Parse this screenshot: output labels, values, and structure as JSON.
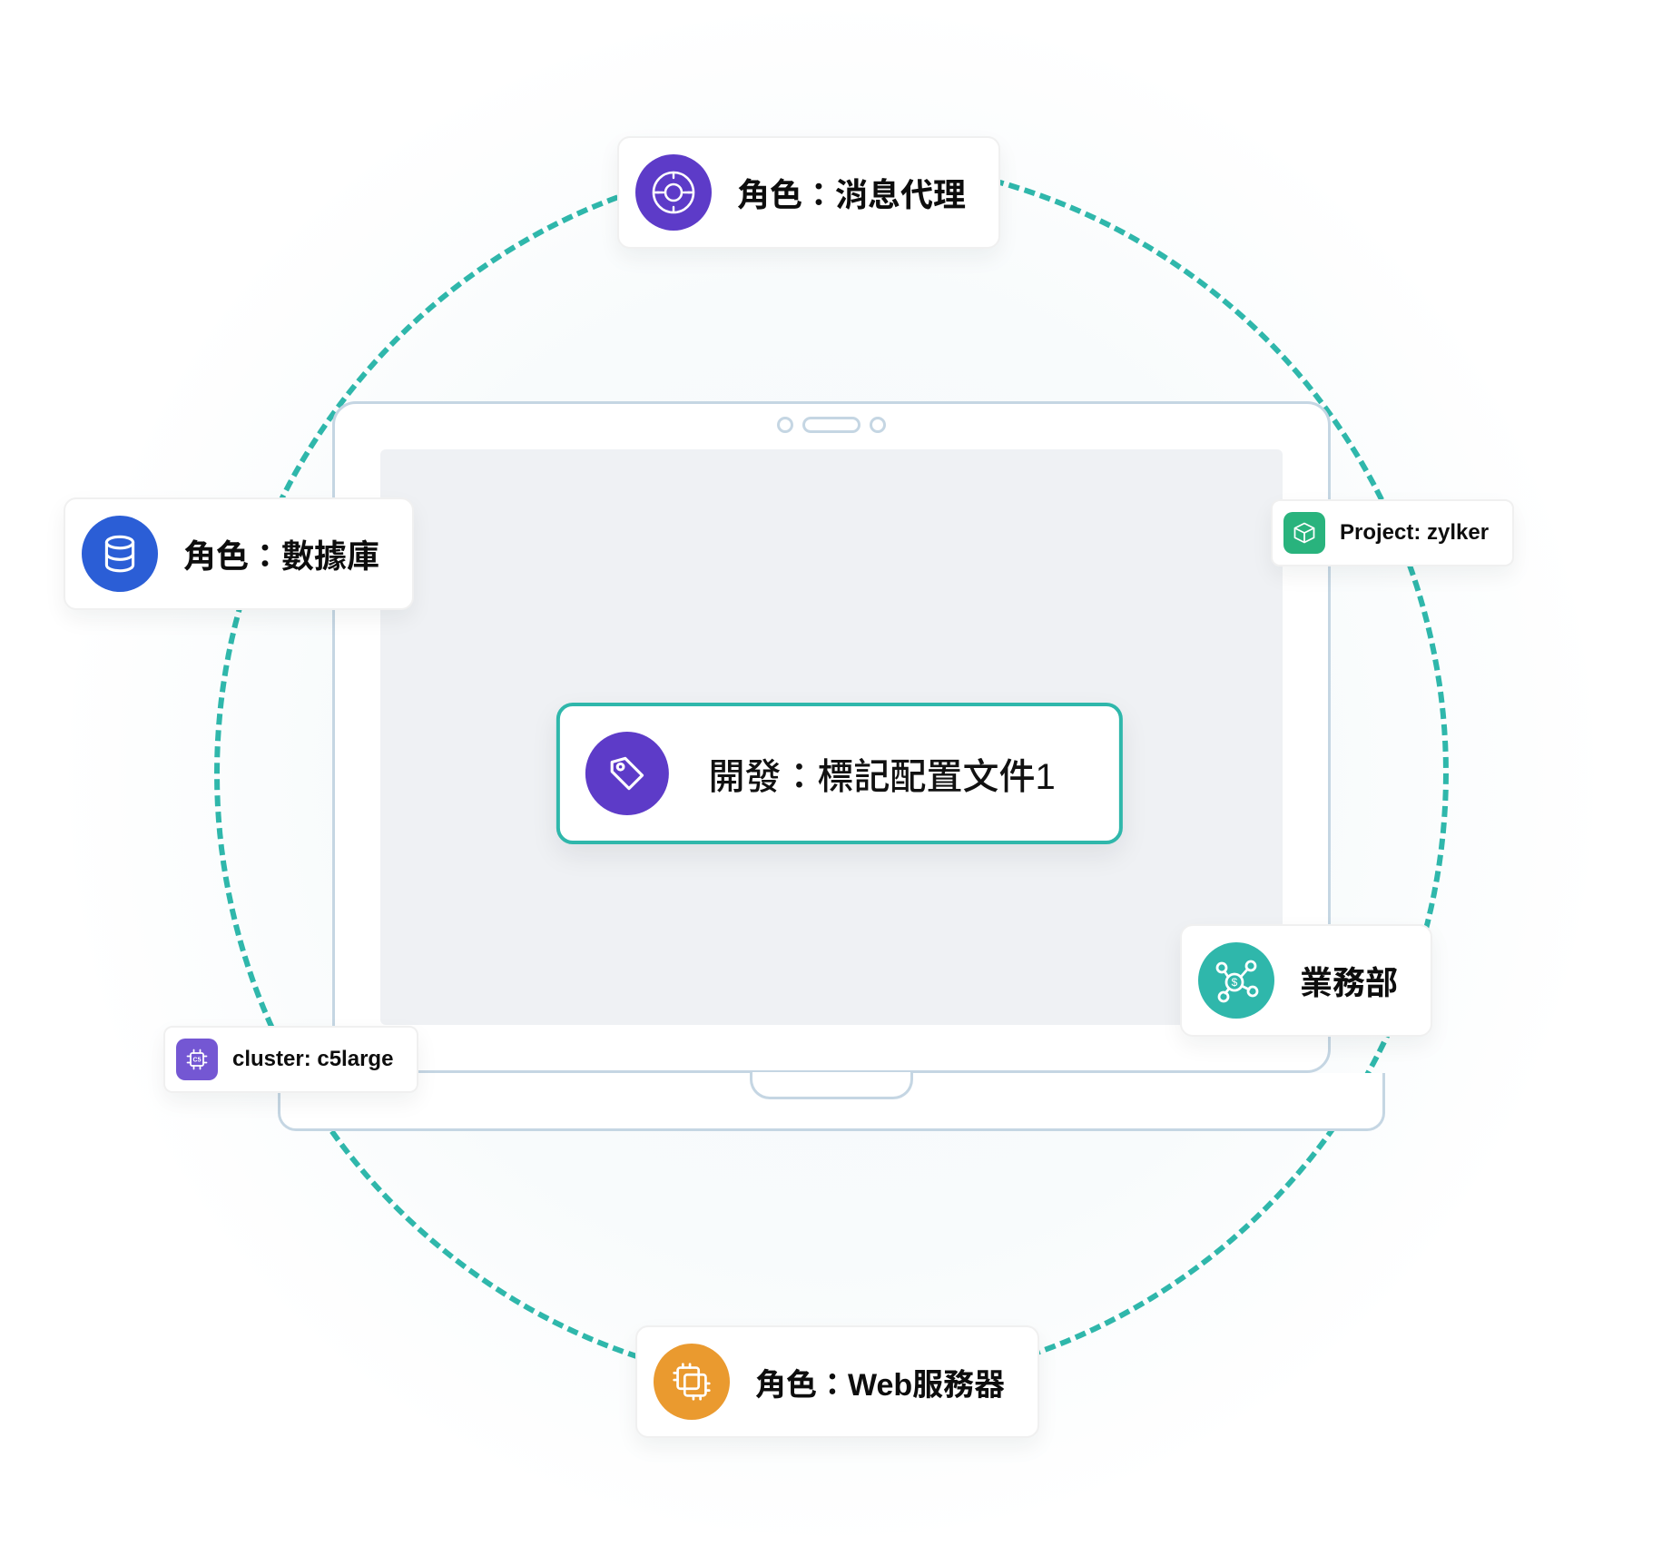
{
  "diagram": {
    "center": {
      "label": "開發：標記配置文件1",
      "icon": "tag-icon",
      "color": "purple"
    },
    "nodes": {
      "top": {
        "label": "角色：消息代理",
        "icon": "message-broker-icon",
        "color": "purple"
      },
      "left": {
        "label": "角色：數據庫",
        "icon": "database-icon",
        "color": "blue"
      },
      "right": {
        "label": "Project: zylker",
        "icon": "cube-icon",
        "color": "green"
      },
      "bottomR": {
        "label": "業務部",
        "icon": "network-money-icon",
        "color": "teal"
      },
      "bottomL": {
        "label": "cluster: c5large",
        "icon": "cpu-icon",
        "color": "purpleSoft"
      },
      "bottom": {
        "label": "角色：Web服務器",
        "icon": "servers-icon",
        "color": "orange"
      }
    },
    "style": {
      "orbitColor": "#2fb7ab",
      "palette": {
        "purple": "#5d3bc8",
        "blue": "#2b5ed6",
        "teal": "#2fb7ab",
        "orange": "#ea9a2f",
        "green": "#29b37d",
        "purpleSoft": "#7457d3"
      }
    }
  }
}
